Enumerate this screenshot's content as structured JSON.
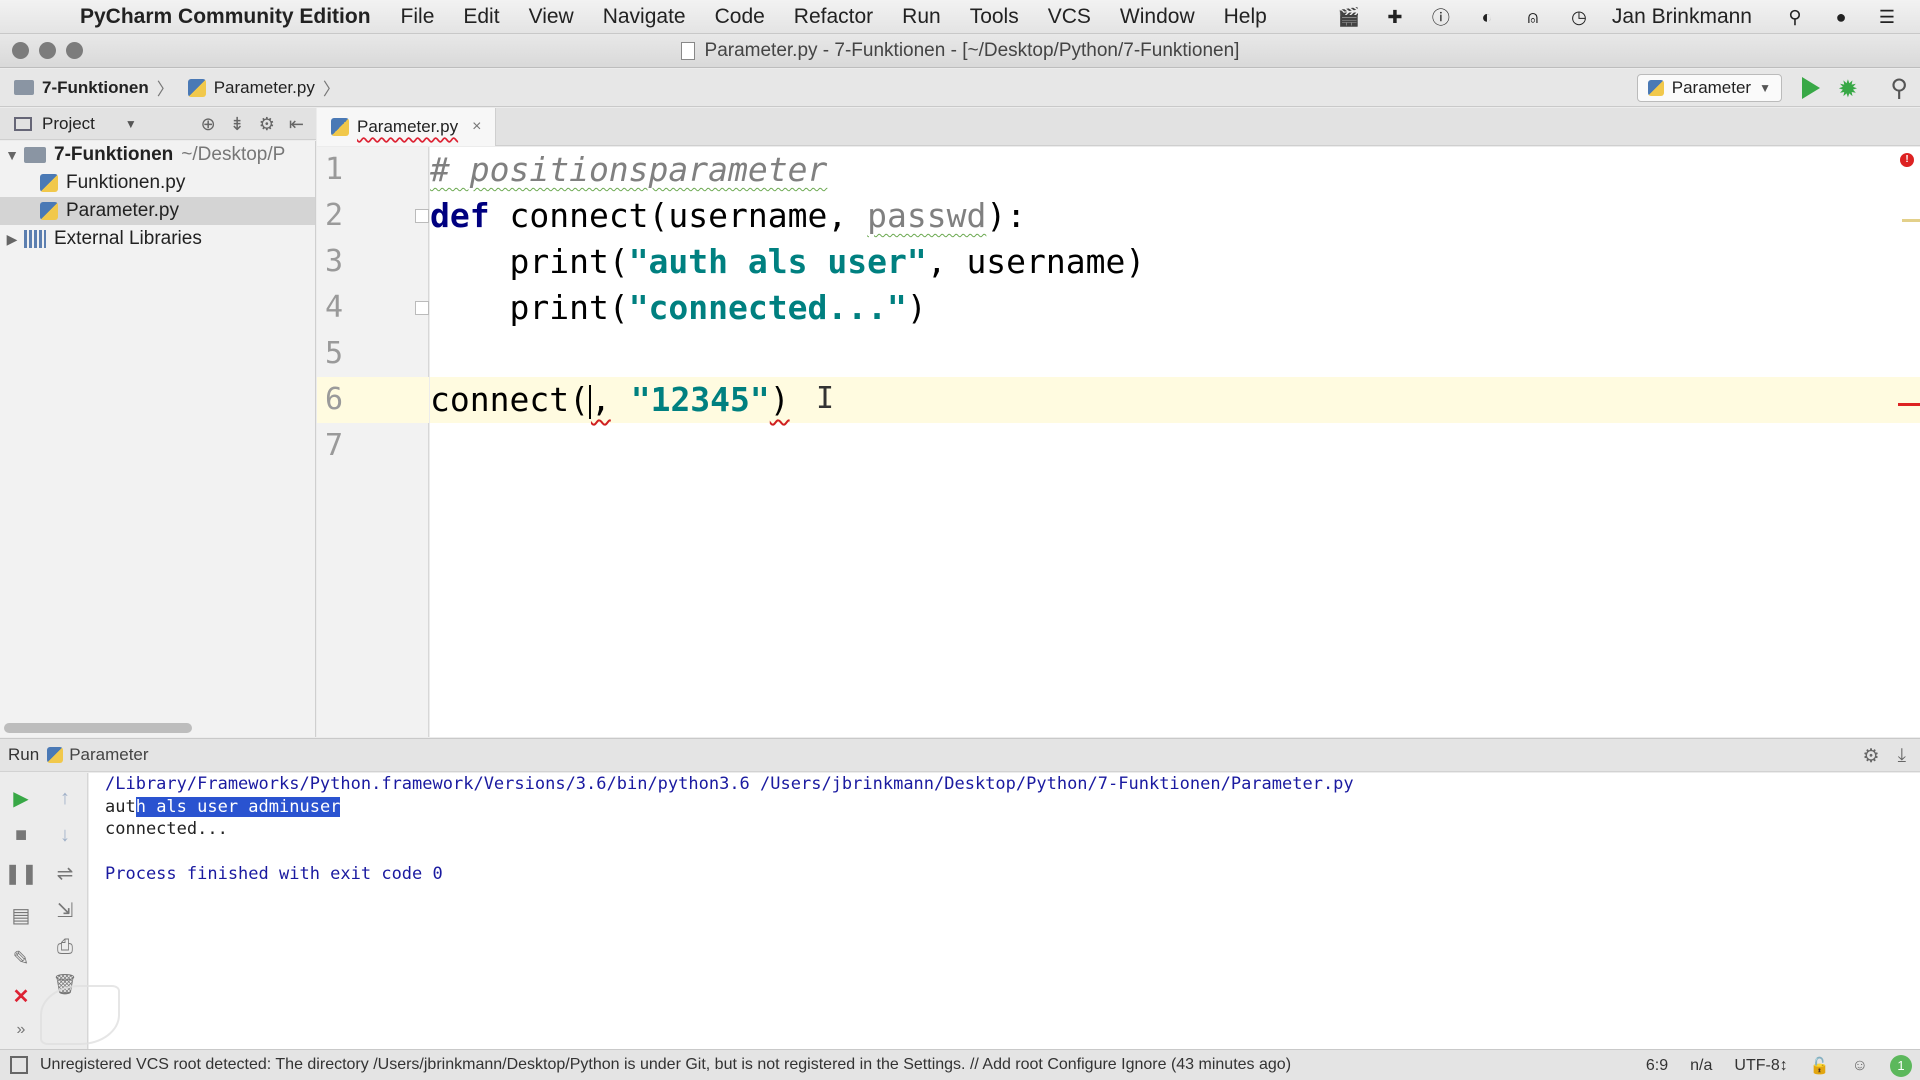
{
  "menubar": {
    "app_name": "PyCharm Community Edition",
    "items": [
      "File",
      "Edit",
      "View",
      "Navigate",
      "Code",
      "Refactor",
      "Run",
      "Tools",
      "VCS",
      "Window",
      "Help"
    ],
    "user_name": "Jan Brinkmann"
  },
  "window": {
    "title": "Parameter.py - 7-Funktionen - [~/Desktop/Python/7-Funktionen]"
  },
  "navbar": {
    "breadcrumb_project": "7-Funktionen",
    "breadcrumb_file": "Parameter.py",
    "run_config": "Parameter"
  },
  "project_panel": {
    "title": "Project",
    "root_name": "7-Funktionen",
    "root_path": "~/Desktop/P",
    "files": [
      "Funktionen.py",
      "Parameter.py"
    ],
    "external": "External Libraries"
  },
  "editor": {
    "tab_label": "Parameter.py",
    "tab_close": "×",
    "line_numbers": [
      "1",
      "2",
      "3",
      "4",
      "5",
      "6",
      "7"
    ],
    "line1_comment": "# positionsparameter",
    "line2_kw": "def",
    "line2_a": " connect(username, ",
    "line2_param": "passwd",
    "line2_b": "):",
    "line3_a": "    print(",
    "line3_str": "\"auth als user\"",
    "line3_b": ", username)",
    "line4_a": "    print(",
    "line4_str": "\"connected...\"",
    "line4_b": ")",
    "line6_a": "connect(",
    "line6_err1": ",",
    "line6_sp": " ",
    "line6_str": "\"12345\"",
    "line6_err2": ")"
  },
  "run_panel": {
    "label": "Run",
    "config_name": "Parameter",
    "console": {
      "command": "/Library/Frameworks/Python.framework/Versions/3.6/bin/python3.6 /Users/jbrinkmann/Desktop/Python/7-Funktionen/Parameter.py",
      "out1_plain": "aut",
      "out1_selected": "h als user adminuser",
      "out2": "connected...",
      "exit": "Process finished with exit code 0"
    }
  },
  "statusbar": {
    "message": "Unregistered VCS root detected: The directory /Users/jbrinkmann/Desktop/Python is under Git, but is not registered in the Settings. // Add root  Configure  Ignore (43 minutes ago)",
    "position": "6:9",
    "na": "n/a",
    "encoding": "UTF-8↕",
    "events_count": "1"
  },
  "colors": {
    "keyword": "#000080",
    "string": "#008080",
    "comment": "#808080",
    "error": "#d02020",
    "run_green": "#38a846",
    "selection": "#2a53d0",
    "current_line": "#fffbe0"
  }
}
